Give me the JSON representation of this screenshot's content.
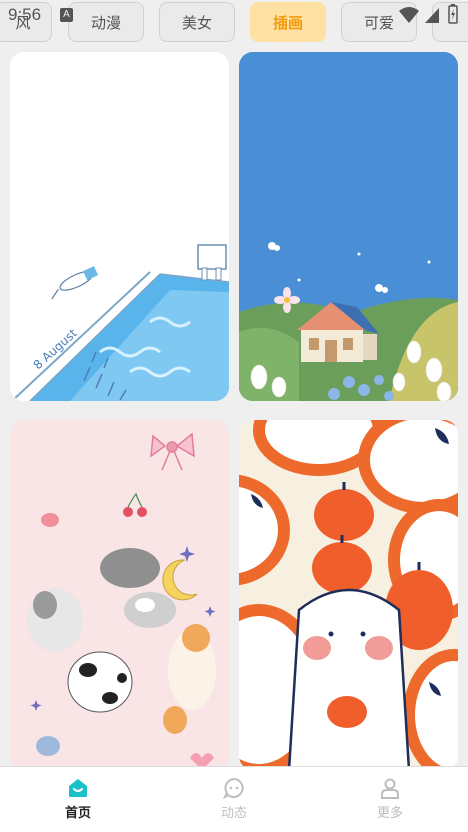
{
  "status_bar": {
    "time": "9:56",
    "badge": "A"
  },
  "tabs": [
    {
      "label": "风"
    },
    {
      "label": "动漫"
    },
    {
      "label": "美女"
    },
    {
      "label": "插画",
      "active": true
    },
    {
      "label": "可爱"
    }
  ],
  "bottom_nav": [
    {
      "label": "首页",
      "icon": "home-icon",
      "active": true
    },
    {
      "label": "动态",
      "icon": "chat-bubble-icon"
    },
    {
      "label": "更多",
      "icon": "person-icon"
    }
  ],
  "colors": {
    "accent": "#f29b0f",
    "active_tab_bg": "#ffe2a3",
    "home_icon": "#19c2c9"
  }
}
